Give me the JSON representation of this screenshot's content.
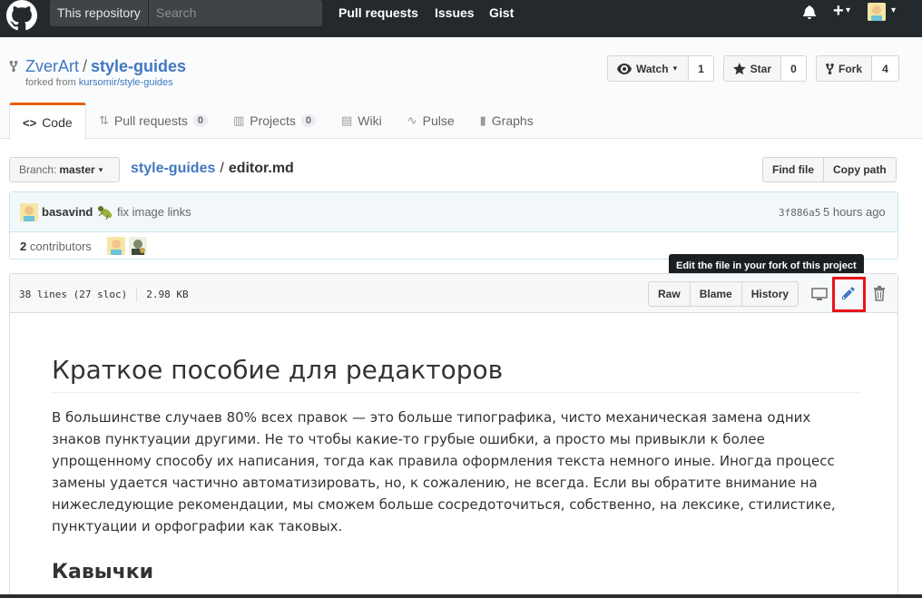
{
  "header": {
    "scope_label": "This repository",
    "search_placeholder": "Search",
    "nav": [
      "Pull requests",
      "Issues",
      "Gist"
    ],
    "plus_label": "+",
    "caret": "▾"
  },
  "repo": {
    "owner": "ZverArt",
    "separator": "/",
    "name": "style-guides",
    "forked_prefix": "forked from",
    "forked_link": "kursomir/style-guides",
    "watch": {
      "label": "Watch",
      "count": "1"
    },
    "star": {
      "label": "Star",
      "count": "0"
    },
    "fork": {
      "label": "Fork",
      "count": "4"
    }
  },
  "tabs": [
    {
      "label": "Code",
      "icon": "code-icon"
    },
    {
      "label": "Pull requests",
      "badge": "0",
      "icon": "pull-request-icon"
    },
    {
      "label": "Projects",
      "badge": "0",
      "icon": "project-icon"
    },
    {
      "label": "Wiki",
      "icon": "book-icon"
    },
    {
      "label": "Pulse",
      "icon": "pulse-icon"
    },
    {
      "label": "Graphs",
      "icon": "graph-icon"
    }
  ],
  "filenav": {
    "branch_prefix": "Branch:",
    "branch": "master",
    "root": "style-guides",
    "sep": "/",
    "file": "editor.md",
    "find_file": "Find file",
    "copy_path": "Copy path"
  },
  "commit": {
    "author": "basavind",
    "message": "fix image links",
    "sha": "3f886a5",
    "time": "5 hours ago",
    "contributors_count": "2",
    "contributors_label": "contributors"
  },
  "file": {
    "lines": "38 lines (27 sloc)",
    "size": "2.98 KB",
    "raw": "Raw",
    "blame": "Blame",
    "history": "History",
    "tooltip": "Edit the file in your fork of this project"
  },
  "content": {
    "h1": "Краткое пособие для редакторов",
    "p1": "В большинстве случаев 80% всех правок — это больше типографика, чисто механическая замена одних знаков пунктуации другими. Не то чтобы какие-то грубые ошибки, а просто мы привыкли к более упрощенному способу их написания, тогда как правила оформления текста немного иные. Иногда процесс замены удается частично автоматизировать, но, к сожалению, не всегда. Если вы обратите внимание на нижеследующие рекомендации, мы сможем больше сосредоточиться, собственно, на лексике, стилистике, пунктуации и орфографии как таковых.",
    "h2": "Кавычки"
  },
  "colors": {
    "header_bg": "#24292e",
    "link": "#4078c0",
    "tab_accent": "#e36209",
    "highlight": "#e8141a"
  }
}
